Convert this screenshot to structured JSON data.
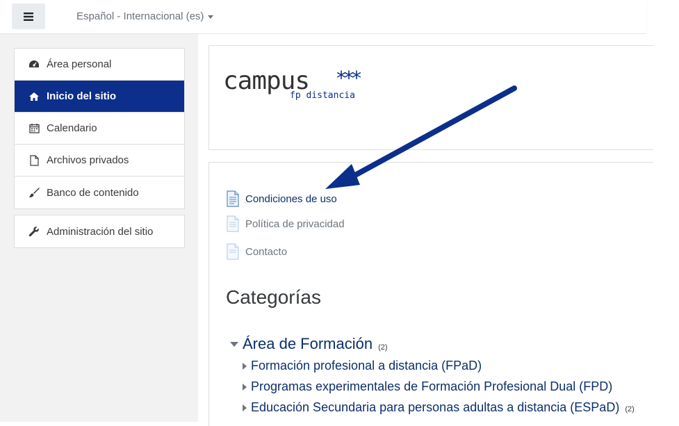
{
  "navbar": {
    "menu_icon": "hamburger-icon",
    "language_selector": "Español - Internacional (es)"
  },
  "sidebar": {
    "items": [
      {
        "label": "Área personal",
        "icon": "dashboard-icon",
        "active": false
      },
      {
        "label": "Inicio del sitio",
        "icon": "home-icon",
        "active": true
      },
      {
        "label": "Calendario",
        "icon": "calendar-icon",
        "active": false
      },
      {
        "label": "Archivos privados",
        "icon": "file-icon",
        "active": false
      },
      {
        "label": "Banco de contenido",
        "icon": "brush-icon",
        "active": false
      }
    ],
    "admin_item": {
      "label": "Administración del sitio",
      "icon": "wrench-icon"
    }
  },
  "logo": {
    "main": "campus",
    "stars": "***",
    "sub": "fp distancia"
  },
  "pages": [
    {
      "label": "Condiciones de uso",
      "icon": "document-icon"
    },
    {
      "label": "Política de privacidad",
      "icon": "document-icon"
    },
    {
      "label": "Contacto",
      "icon": "document-icon"
    }
  ],
  "categories": {
    "heading": "Categorías",
    "root": {
      "label": "Área de Formación",
      "count": "(2)"
    },
    "children": [
      {
        "label": "Formación profesional a distancia (FPaD)",
        "count": ""
      },
      {
        "label": "Programas experimentales de Formación Profesional Dual (FPD)",
        "count": ""
      },
      {
        "label": "Educación Secundaria para personas adultas a distancia (ESPaD)",
        "count": "(2)"
      }
    ]
  },
  "colors": {
    "brand": "#0b2f8a",
    "link": "#0b2f6a",
    "annotation_arrow": "#0b2f8a"
  }
}
